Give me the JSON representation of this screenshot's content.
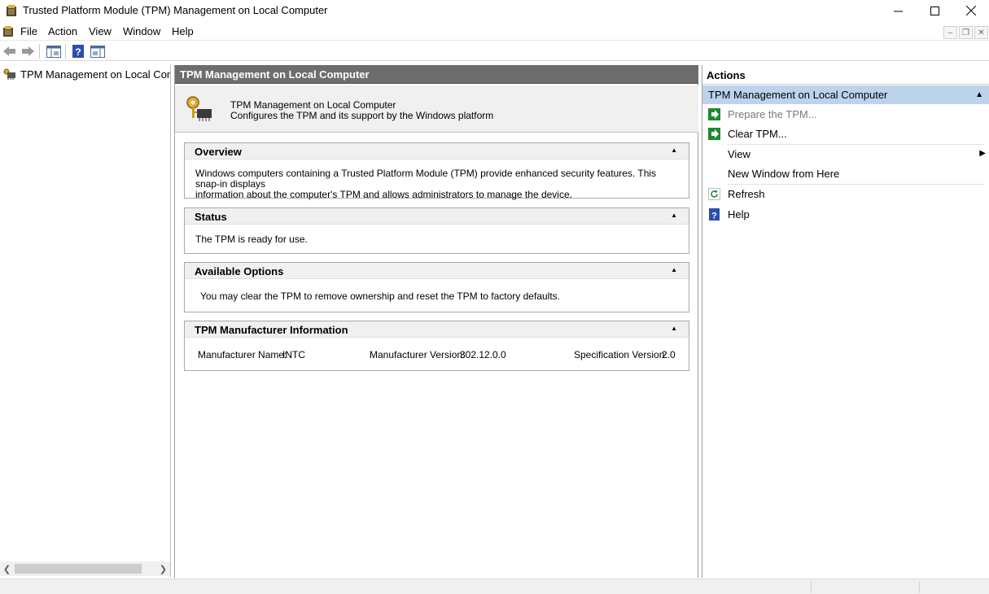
{
  "window": {
    "title": "Trusted Platform Module (TPM) Management on Local Computer"
  },
  "menu": {
    "items": [
      "File",
      "Action",
      "View",
      "Window",
      "Help"
    ]
  },
  "tree": {
    "root_label": "TPM Management on Local Comp"
  },
  "center": {
    "header": "TPM Management on Local Computer",
    "sub_title": "TPM Management on Local Computer",
    "sub_desc": "Configures the TPM and its support by the Windows platform",
    "sections": {
      "overview": {
        "title": "Overview",
        "line1": "Windows computers containing a Trusted Platform Module (TPM) provide enhanced security features. This snap-in displays",
        "line2": "information about the computer's TPM and allows administrators to manage the device."
      },
      "status": {
        "title": "Status",
        "text": "The TPM is ready for use."
      },
      "options": {
        "title": "Available Options",
        "text": "You may clear the TPM to remove ownership and reset the TPM to factory defaults."
      },
      "manufacturer": {
        "title": "TPM Manufacturer Information",
        "name_label": "Manufacturer Name:",
        "name_value": "INTC",
        "version_label": "Manufacturer Version:",
        "version_value": "302.12.0.0",
        "spec_label": "Specification Version:",
        "spec_value": "2.0"
      }
    }
  },
  "actions": {
    "header": "Actions",
    "group_title": "TPM Management on Local Computer",
    "items": [
      {
        "label": "Prepare the TPM...",
        "icon": "green-arrow-icon",
        "disabled": true
      },
      {
        "label": "Clear TPM...",
        "icon": "green-arrow-icon",
        "disabled": false
      },
      {
        "label": "View",
        "icon": "",
        "disabled": false
      },
      {
        "label": "New Window from Here",
        "icon": "",
        "disabled": false
      },
      {
        "label": "Refresh",
        "icon": "refresh-icon",
        "disabled": false
      },
      {
        "label": "Help",
        "icon": "help-icon",
        "disabled": false
      }
    ]
  },
  "colors": {
    "center_header_bg": "#6d6d6d",
    "actions_group_bg": "#bcd3ec",
    "action_green": "#1e8a2f",
    "help_blue": "#2c4fa8"
  }
}
